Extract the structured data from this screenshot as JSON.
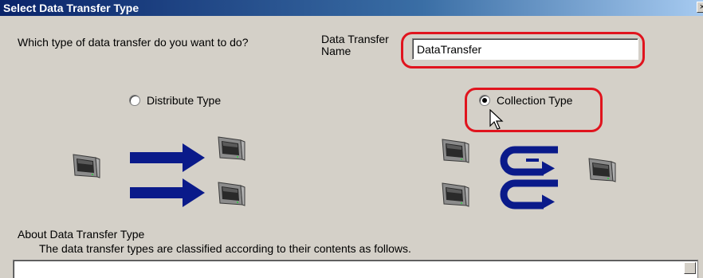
{
  "window": {
    "title": "Select Data Transfer Type",
    "close_glyph": "×"
  },
  "form": {
    "question": "Which type of data transfer do you want to do?",
    "name_label_line1": "Data Transfer",
    "name_label_line2": "Name",
    "name_value": "DataTransfer"
  },
  "options": {
    "distribute": {
      "label": "Distribute Type",
      "selected": false
    },
    "collection": {
      "label": "Collection Type",
      "selected": true
    }
  },
  "about": {
    "title": "About Data Transfer Type",
    "description": "The data transfer types are classified according to their contents as follows."
  },
  "colors": {
    "highlight": "#e0141e",
    "arrow": "#0a1a8a",
    "dialog_bg": "#d4d0c8"
  },
  "icons": [
    "monitor-icon",
    "arrow-right-icon",
    "collection-arrow-icon",
    "mouse-cursor-icon"
  ]
}
